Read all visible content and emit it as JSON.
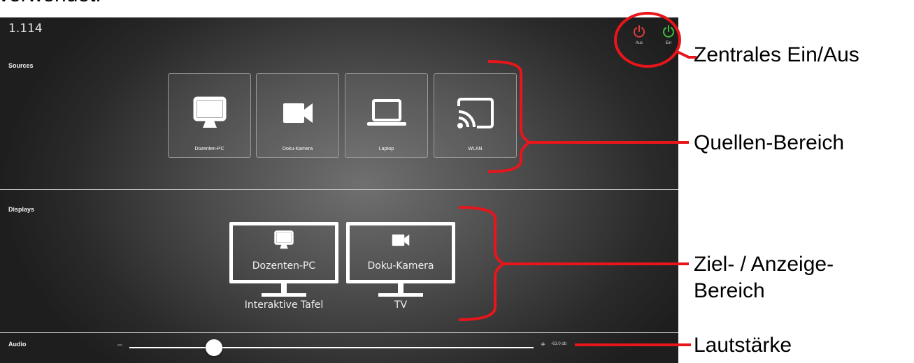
{
  "caption_partial": "verwendet.",
  "app": {
    "version": "1.114",
    "power": {
      "off_label": "Aus",
      "on_label": "Ein",
      "off_color": "#e23b3b",
      "on_color": "#3fbf3f"
    }
  },
  "sources": {
    "title": "Sources",
    "items": [
      {
        "label": "Dozenten-PC",
        "icon": "monitor-icon"
      },
      {
        "label": "Doku-Kamera",
        "icon": "video-camera-icon"
      },
      {
        "label": "Laptop",
        "icon": "laptop-icon"
      },
      {
        "label": "WLAN",
        "icon": "cast-icon"
      }
    ]
  },
  "displays": {
    "title": "Displays",
    "items": [
      {
        "source": "Dozenten-PC",
        "name": "Interaktive Tafel",
        "source_icon": "monitor-icon"
      },
      {
        "source": "Doku-Kamera",
        "name": "TV",
        "source_icon": "video-camera-icon"
      }
    ]
  },
  "audio": {
    "title": "Audio",
    "minus": "–",
    "plus": "+",
    "value_text": "-63.0 db",
    "level": 0.21
  },
  "annotations": {
    "power": "Zentrales Ein/Aus",
    "sources": "Quellen-Bereich",
    "displays_line1": "Ziel- / Anzeige-",
    "displays_line2": "Bereich",
    "volume": "Lautstärke",
    "color": "#e8151b"
  }
}
